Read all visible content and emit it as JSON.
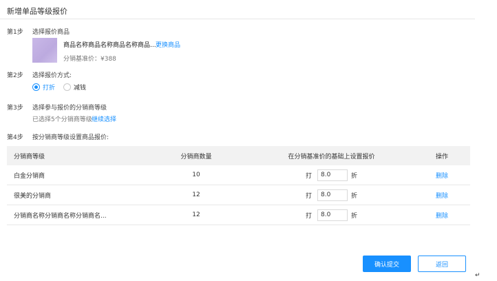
{
  "page": {
    "title": "新增单品等级报价"
  },
  "steps": [
    {
      "num": "第1步",
      "label": "选择报价商品"
    },
    {
      "num": "第2步",
      "label": "选择报价方式:"
    },
    {
      "num": "第3步",
      "label": "选择参与报价的分销商等级"
    },
    {
      "num": "第4步",
      "label": "按分销商等级设置商品报价:"
    }
  ],
  "product": {
    "name": "商品名称商品名称商品名称商品...",
    "change_link": "更换商品",
    "base_price": "分销基准价：¥388"
  },
  "pricing_method": {
    "options": [
      {
        "label": "打折",
        "selected": true
      },
      {
        "label": "减钱",
        "selected": false
      }
    ]
  },
  "levels": {
    "selected_text": "已选择5个分销商等级",
    "continue_link": "继续选择"
  },
  "table": {
    "headers": [
      "分销商等级",
      "分销商数量",
      "在分销基准价的基础上设置报价",
      "操作"
    ],
    "prefix": "打",
    "suffix": "折",
    "rows": [
      {
        "level": "白金分销商",
        "count": "10",
        "discount": "8.0",
        "action": "删除"
      },
      {
        "level": "很美的分销商",
        "count": "12",
        "discount": "8.0",
        "action": "删除"
      },
      {
        "level": "分销商名称分销商名称分销商名...",
        "count": "12",
        "discount": "8.0",
        "action": "删除"
      }
    ]
  },
  "buttons": {
    "submit": "确认提交",
    "back": "返回"
  },
  "return_mark": "↵",
  "colors": {
    "accent": "#1890ff",
    "header_bg": "#f2f2f2"
  }
}
